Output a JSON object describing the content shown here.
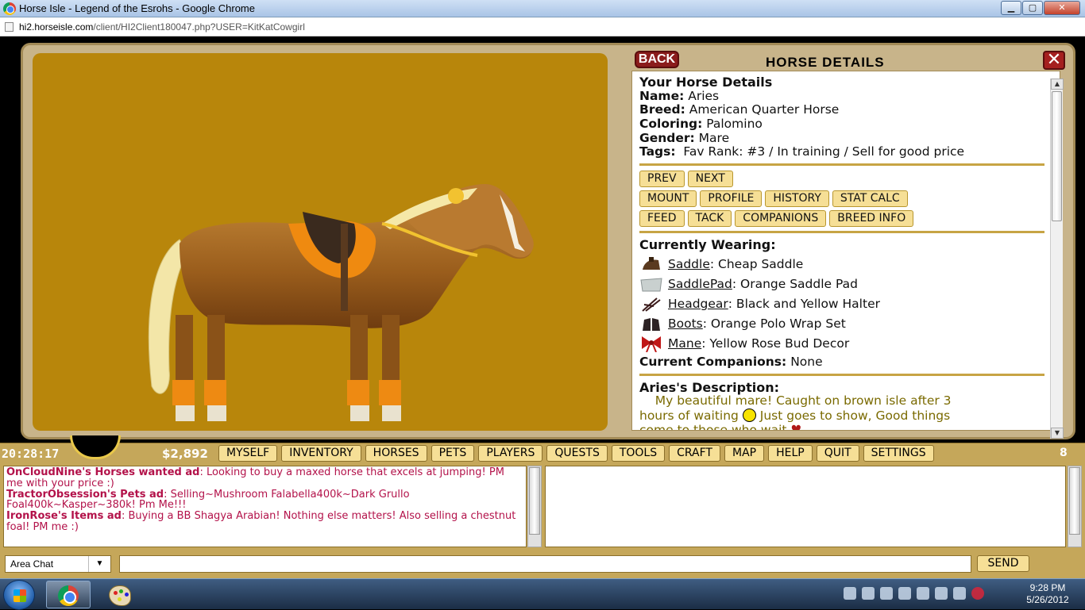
{
  "browser": {
    "title": "Horse Isle - Legend of the Esrohs - Google Chrome",
    "url_domain": "hi2.horseisle.com",
    "url_path": "/client/HI2Client180047.php?USER=KitKatCowgirl",
    "buttons": {
      "minimize": "▁",
      "maximize": "▢",
      "close": "✕"
    }
  },
  "panel": {
    "back_label": "BACK",
    "title": "HORSE DETAILS",
    "close_label": "✕"
  },
  "horse": {
    "heading": "Your Horse Details",
    "name_label": "Name:",
    "name": "Aries",
    "breed_label": "Breed:",
    "breed": "American Quarter Horse",
    "coloring_label": "Coloring:",
    "coloring": "Palomino",
    "gender_label": "Gender:",
    "gender": "Mare",
    "tags_label": "Tags:",
    "tags": "Fav Rank: #3 / In training / Sell for good price"
  },
  "actions": {
    "row1": [
      "PREV",
      "NEXT"
    ],
    "row2": [
      "MOUNT",
      "PROFILE",
      "HISTORY",
      "STAT CALC"
    ],
    "row3": [
      "FEED",
      "TACK",
      "COMPANIONS",
      "BREED INFO"
    ]
  },
  "wearing": {
    "heading": "Currently Wearing:",
    "items": [
      {
        "slot": "Saddle",
        "value": ": Cheap Saddle",
        "icon": "saddle-icon"
      },
      {
        "slot": "SaddlePad",
        "value": ": Orange Saddle Pad",
        "icon": "saddle-pad-icon"
      },
      {
        "slot": "Headgear",
        "value": ": Black and Yellow Halter",
        "icon": "halter-icon"
      },
      {
        "slot": "Boots",
        "value": ": Orange Polo Wrap Set",
        "icon": "boots-icon"
      },
      {
        "slot": "Mane",
        "value": ": Yellow Rose Bud Decor",
        "icon": "bow-icon"
      }
    ],
    "companions_label": "Current Companions:",
    "companions": "None"
  },
  "description": {
    "heading": "Aries's Description:",
    "text_1": "My beautiful mare! Caught on brown isle after 3",
    "text_2a": "hours of waiting",
    "text_2b": "Just goes to show, Good things",
    "text_3": "come to those who wait"
  },
  "toolbar": {
    "clock": "20:28:17",
    "money": "$2,892",
    "tabs": [
      "MYSELF",
      "INVENTORY",
      "HORSES",
      "PETS",
      "PLAYERS",
      "QUESTS",
      "TOOLS",
      "CRAFT",
      "MAP",
      "HELP",
      "QUIT",
      "SETTINGS"
    ],
    "online_count": "8"
  },
  "chat": {
    "messages": [
      {
        "sender": "OnCloudNine's Horses wanted ad",
        "text": ": Looking to buy a maxed horse that excels at jumping! PM me with your price :)"
      },
      {
        "sender": "TractorObsession's Pets ad",
        "text": ": Selling~Mushroom Falabella400k~Dark Grullo Foal400k~Kasper~380k! Pm Me!!!"
      },
      {
        "sender": "IronRose's Items ad",
        "text": ": Buying a BB Shagya Arabian! Nothing else matters! Also selling a chestnut foal! PM me :)"
      }
    ],
    "channel": "Area Chat",
    "send_label": "SEND",
    "input_value": ""
  },
  "taskbar": {
    "time": "9:28 PM",
    "date": "5/26/2012"
  },
  "colors": {
    "frame": "#c8b48a",
    "horse_bg": "#b8860b",
    "button_fill": "#f6df96",
    "rule_gold": "#c7a444",
    "chat_text": "#b3124a",
    "description_text": "#7a6a00"
  }
}
